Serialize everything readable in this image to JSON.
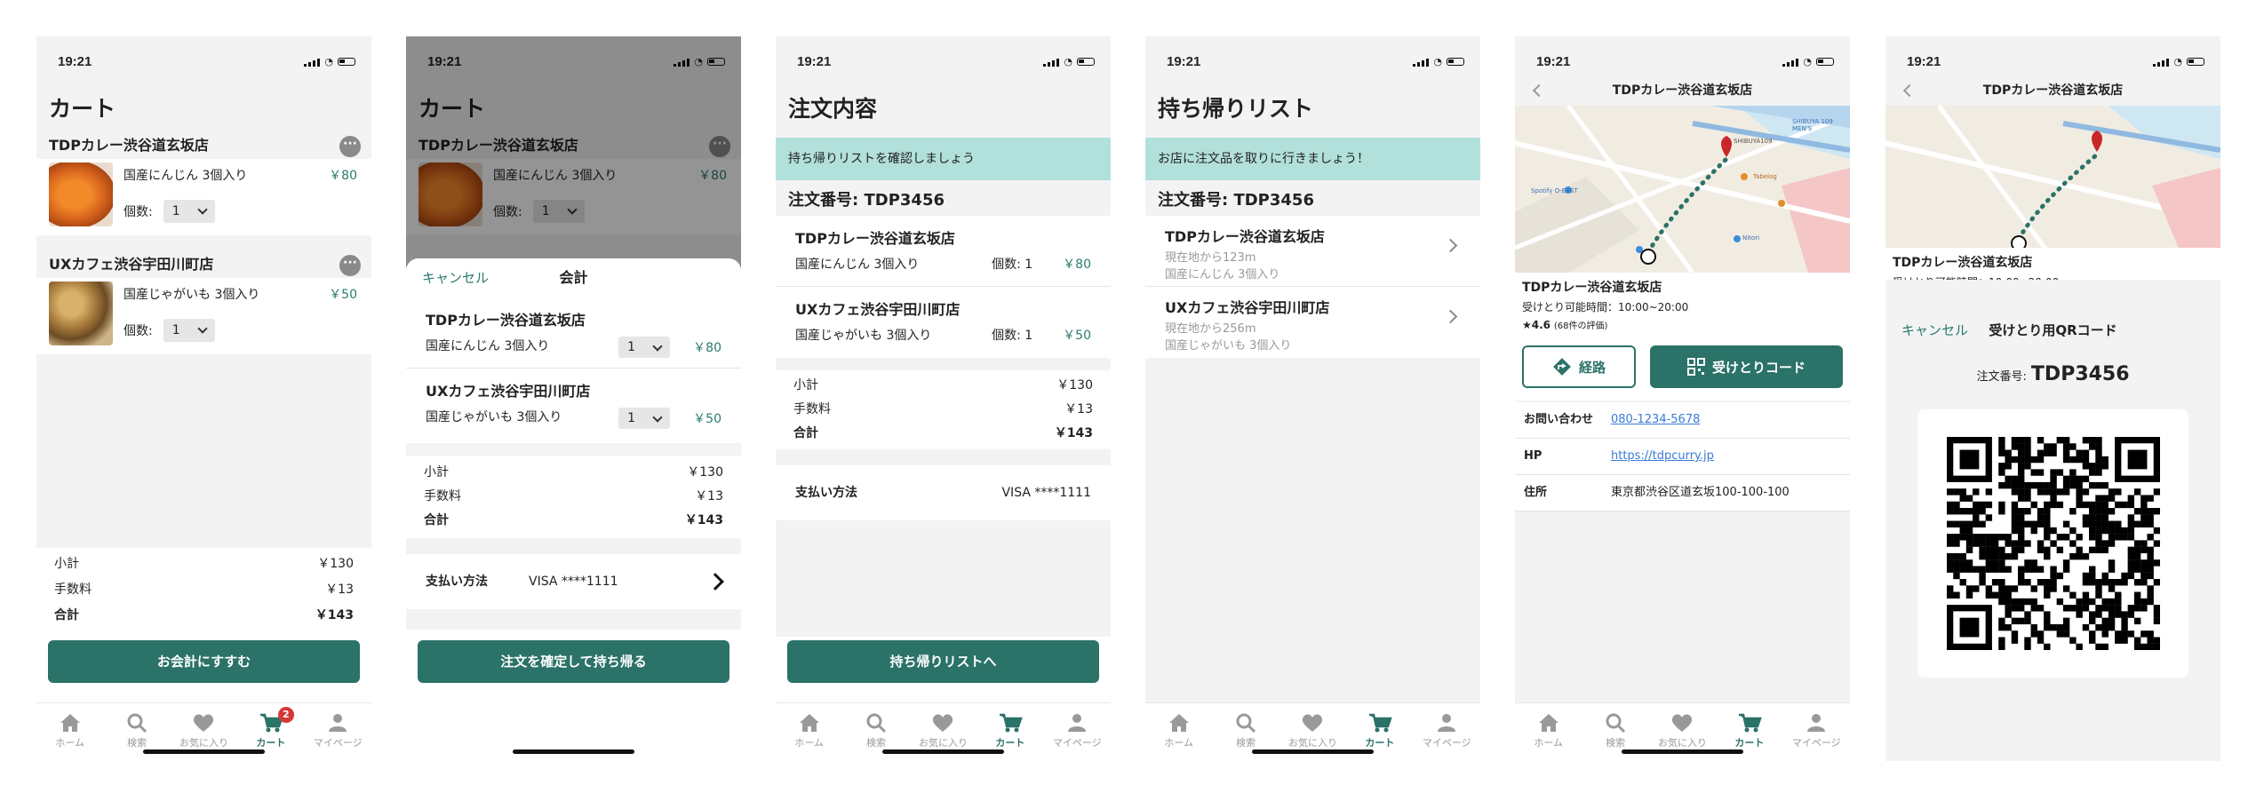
{
  "status": {
    "time": "19:21"
  },
  "tabs": [
    {
      "label": "ホーム",
      "icon": "home-icon"
    },
    {
      "label": "検索",
      "icon": "search-icon"
    },
    {
      "label": "お気に入り",
      "icon": "heart-icon"
    },
    {
      "label": "カート",
      "icon": "cart-icon"
    },
    {
      "label": "マイページ",
      "icon": "user-icon"
    }
  ],
  "cart_badge": "2",
  "cart": {
    "title": "カート",
    "stores": [
      {
        "name": "TDPカレー渋谷道玄坂店",
        "item": "国産にんじん 3個入り",
        "price": "￥80",
        "qty_label": "個数:",
        "qty": "1"
      },
      {
        "name": "UXカフェ渋谷宇田川町店",
        "item": "国産じゃがいも 3個入り",
        "price": "￥50",
        "qty_label": "個数:",
        "qty": "1"
      }
    ],
    "subtotal_label": "小計",
    "subtotal": "￥130",
    "fee_label": "手数料",
    "fee": "￥13",
    "total_label": "合計",
    "total": "￥143",
    "checkout_button": "お会計にすすむ"
  },
  "checkout": {
    "cancel": "キャンセル",
    "title": "会計",
    "stores": [
      {
        "name": "TDPカレー渋谷道玄坂店",
        "item": "国産にんじん 3個入り",
        "qty": "1",
        "price": "￥80"
      },
      {
        "name": "UXカフェ渋谷宇田川町店",
        "item": "国産じゃがいも 3個入り",
        "qty": "1",
        "price": "￥50"
      }
    ],
    "subtotal": "￥130",
    "fee": "￥13",
    "total": "￥143",
    "payment_label": "支払い方法",
    "payment": "VISA ****1111",
    "confirm_button": "注文を確定して持ち帰る"
  },
  "order": {
    "title": "注文内容",
    "banner": "持ち帰りリストを確認しましょう",
    "order_no_label": "注文番号:",
    "order_no": "TDP3456",
    "stores": [
      {
        "name": "TDPカレー渋谷道玄坂店",
        "item": "国産にんじん 3個入り",
        "qty": "個数: 1",
        "price": "￥80"
      },
      {
        "name": "UXカフェ渋谷宇田川町店",
        "item": "国産じゃがいも 3個入り",
        "qty": "個数: 1",
        "price": "￥50"
      }
    ],
    "subtotal": "￥130",
    "fee": "￥13",
    "total": "￥143",
    "payment_label": "支払い方法",
    "payment": "VISA ****1111",
    "button": "持ち帰りリストへ"
  },
  "takeout": {
    "title": "持ち帰りリスト",
    "banner": "お店に注文品を取りに行きましょう！",
    "order_no": "注文番号: TDP3456",
    "stores": [
      {
        "name": "TDPカレー渋谷道玄坂店",
        "distance": "現在地から123m",
        "item": "国産にんじん 3個入り"
      },
      {
        "name": "UXカフェ渋谷宇田川町店",
        "distance": "現在地から256m",
        "item": "国産じゃがいも 3個入り"
      }
    ]
  },
  "store": {
    "title": "TDPカレー渋谷道玄坂店",
    "name": "TDPカレー渋谷道玄坂店",
    "hours": "受けとり可能時間：10:00~20:00",
    "rating": "★4.6",
    "reviews": "(68件の評価)",
    "route_button": "経路",
    "code_button": "受けとりコード",
    "contact_label": "お問い合わせ",
    "contact": "080-1234-5678",
    "hp_label": "HP",
    "hp": "https://tdpcurry.jp",
    "address_label": "住所",
    "address": "東京都渋谷区道玄坂100-100-100",
    "map_labels": [
      "SHIBUYA109",
      "Spotify O-EAST",
      "Tabelog",
      "Nitori",
      "SHIBUYA 109 MEN'S"
    ]
  },
  "qr": {
    "cancel": "キャンセル",
    "title": "受けとり用QRコード",
    "order_no_label": "注文番号:",
    "order_no": "TDP3456"
  }
}
